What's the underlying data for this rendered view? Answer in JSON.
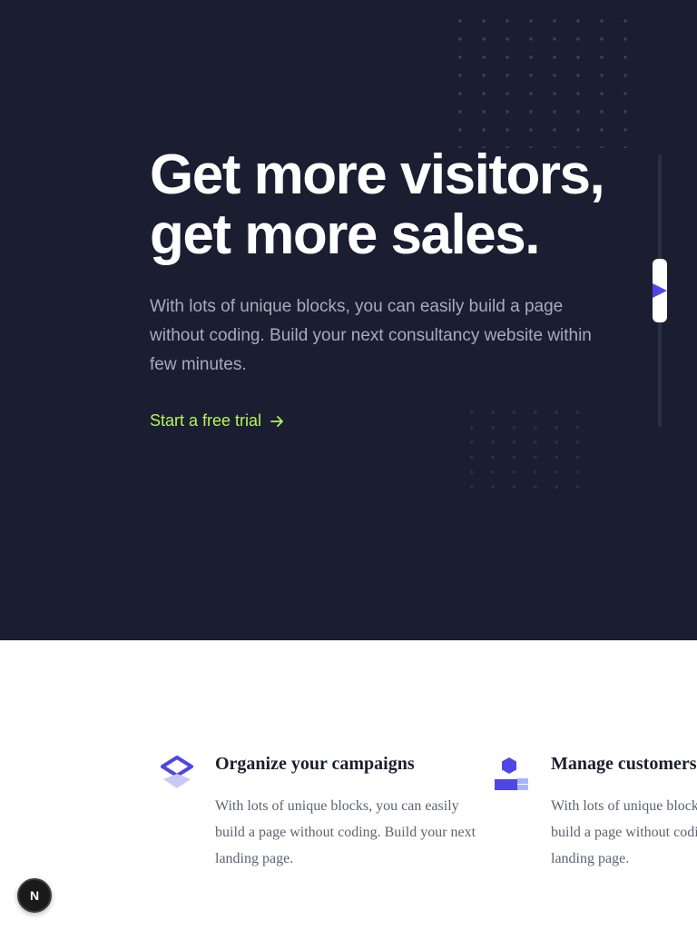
{
  "hero": {
    "title_line1": "Get more visitors,",
    "title_line2": "get more sales.",
    "subtitle": "With lots of unique blocks, you can easily build a page without coding. Build your next consultancy website within few minutes.",
    "cta_label": "Start a free trial",
    "cta_icon": "arrow-right-icon"
  },
  "features": [
    {
      "icon": "layers-icon",
      "title": "Organize your campaigns",
      "text": "With lots of unique blocks, you can easily build a page without coding. Build your next landing page."
    },
    {
      "icon": "customers-icon",
      "title": "Manage customers",
      "text": "With lots of unique blocks, you can easily build a page without coding. Build your next landing page."
    }
  ],
  "colors": {
    "hero_bg": "#1b1e31",
    "accent_green": "#b6f35b",
    "accent_purple": "#4f46e5",
    "light_purple": "#a5b4fc"
  },
  "badge": {
    "label": "N"
  }
}
